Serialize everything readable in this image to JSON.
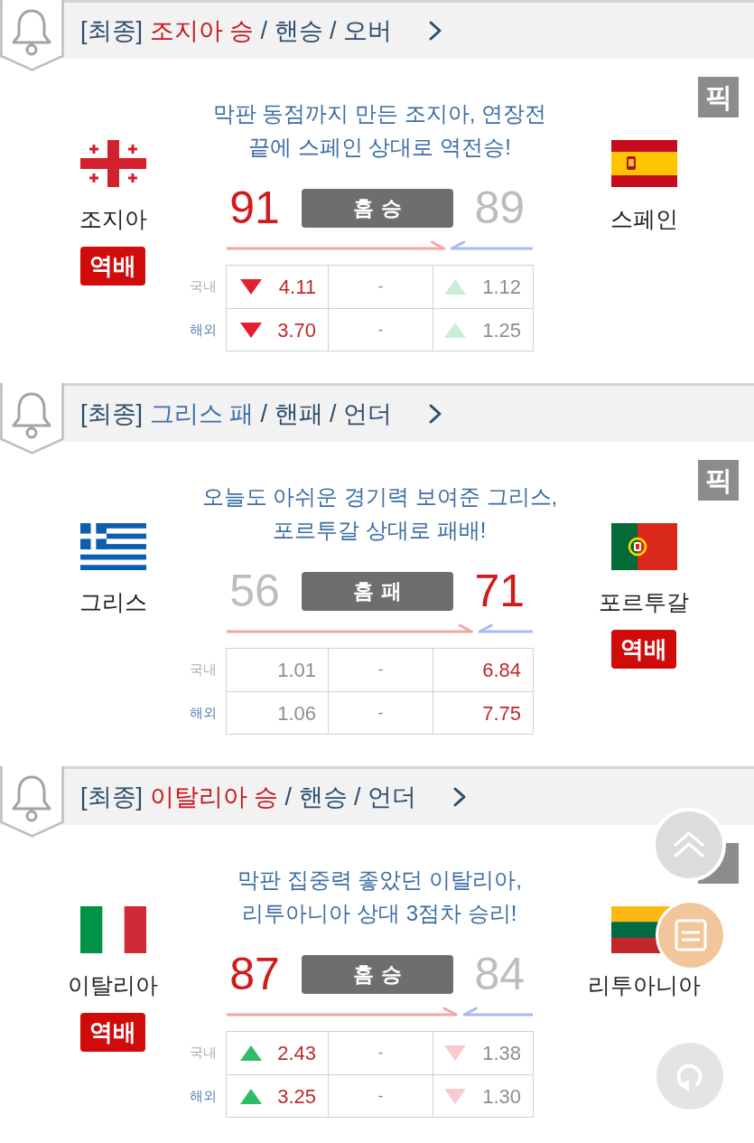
{
  "cards": [
    {
      "header": {
        "tag": "[최종]",
        "result": "조지아 승",
        "won": true,
        "rest": "/ 핸승 / 오버"
      },
      "pick_badge": true,
      "pick": "픽",
      "headline": [
        "막판 동점까지 만든 조지아, 연장전",
        "끝에 스페인 상대로 역전승!"
      ],
      "home": {
        "name": "조지아",
        "flag": {
          "kind": "georgia"
        },
        "score": "91",
        "won": true,
        "badge": "역배"
      },
      "away": {
        "name": "스페인",
        "flag": {
          "kind": "spain"
        },
        "score": "89",
        "won": false
      },
      "result_badge": "홈승",
      "bet_split": {
        "level": 0.72
      },
      "odds": [
        {
          "label": "국내",
          "kind": "domestic",
          "cells": [
            {
              "value": "4.11",
              "kind": "down",
              "highlight": true
            },
            {
              "value": "-",
              "kind": "plain",
              "highlight": false
            },
            {
              "value": "1.12",
              "kind": "up",
              "highlight": false
            }
          ]
        },
        {
          "label": "해외",
          "kind": "overseas",
          "cells": [
            {
              "value": "3.70",
              "kind": "down",
              "highlight": true
            },
            {
              "value": "-",
              "kind": "plain",
              "highlight": false
            },
            {
              "value": "1.25",
              "kind": "up",
              "highlight": false
            }
          ]
        }
      ]
    },
    {
      "header": {
        "tag": "[최종]",
        "result": "그리스 패",
        "won": false,
        "rest": "/ 핸패 / 언더"
      },
      "pick_badge": true,
      "pick": "픽",
      "headline": [
        "오늘도 아쉬운 경기력 보여준 그리스,",
        "포르투갈 상대로 패배!"
      ],
      "home": {
        "name": "그리스",
        "flag": {
          "kind": "greece"
        },
        "score": "56",
        "won": false
      },
      "away": {
        "name": "포르투갈",
        "flag": {
          "kind": "portugal"
        },
        "score": "71",
        "won": true,
        "badge": "역배"
      },
      "result_badge": "홈패",
      "bet_split": {
        "level": 0.81
      },
      "odds": [
        {
          "label": "국내",
          "kind": "domestic",
          "cells": [
            {
              "value": "1.01",
              "kind": "plain",
              "highlight": false
            },
            {
              "value": "-",
              "kind": "plain",
              "highlight": false
            },
            {
              "value": "6.84",
              "kind": "plain",
              "highlight": true
            }
          ]
        },
        {
          "label": "해외",
          "kind": "overseas",
          "cells": [
            {
              "value": "1.06",
              "kind": "plain",
              "highlight": false
            },
            {
              "value": "-",
              "kind": "plain",
              "highlight": false
            },
            {
              "value": "7.75",
              "kind": "plain",
              "highlight": true
            }
          ]
        }
      ]
    },
    {
      "header": {
        "tag": "[최종]",
        "result": "이탈리아 승",
        "won": true,
        "rest": "/ 핸승 / 언더"
      },
      "pick_badge": true,
      "headline": [
        "막판 집중력 좋았던 이탈리아,",
        "리투아니아 상대 3점차 승리!"
      ],
      "home": {
        "name": "이탈리아",
        "flag": {
          "kind": "italy"
        },
        "score": "87",
        "won": true,
        "badge": "역배"
      },
      "away": {
        "name": "리투아니아",
        "flag": {
          "kind": "lithuania"
        },
        "score": "84",
        "won": false
      },
      "result_badge": "홈승",
      "bet_split": {
        "level": 0.76
      },
      "odds": [
        {
          "label": "국내",
          "kind": "domestic",
          "cells": [
            {
              "value": "2.43",
              "kind": "up",
              "highlight": true
            },
            {
              "value": "-",
              "kind": "plain",
              "highlight": false
            },
            {
              "value": "1.38",
              "kind": "down",
              "highlight": false
            }
          ]
        },
        {
          "label": "해외",
          "kind": "overseas",
          "cells": [
            {
              "value": "3.25",
              "kind": "up",
              "highlight": true
            },
            {
              "value": "-",
              "kind": "plain",
              "highlight": false
            },
            {
              "value": "1.30",
              "kind": "down",
              "highlight": false
            }
          ]
        }
      ]
    }
  ],
  "floating_buttons": [
    {
      "kind": "scroll_top"
    },
    {
      "kind": "list"
    },
    {
      "kind": "refresh"
    }
  ]
}
